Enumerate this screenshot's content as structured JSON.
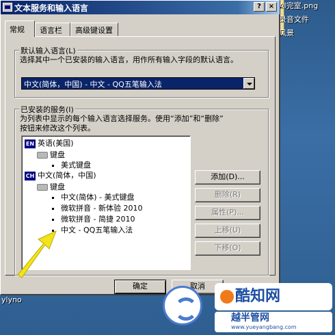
{
  "desktop": {
    "items": [
      {
        "label": "AI完室.png"
      },
      {
        "label": "录音文件"
      },
      {
        "label": "风景"
      },
      {
        "label": "ylyno"
      }
    ]
  },
  "window": {
    "title": "文本服务和输入语言",
    "help_glyph": "?",
    "close_glyph": "×"
  },
  "tabs": [
    {
      "label": "常规"
    },
    {
      "label": "语言栏"
    },
    {
      "label": "高级键设置"
    }
  ],
  "default_language": {
    "legend": "默认输入语言(L)",
    "description": "选择其中一个已安装的输入语言，用作所有输入字段的默认语言。",
    "selected": "中文(简体，中国) - 中文 - QQ五笔输入法"
  },
  "installed_services": {
    "legend": "已安装的服务(I)",
    "description_line1": "为列表中显示的每个输入语言选择服务。使用“添加”和“删除”",
    "description_line2": "按钮来修改这个列表。",
    "tree": [
      {
        "kind": "lang",
        "badge": "EN",
        "label": "英语(美国)"
      },
      {
        "kind": "category",
        "label": "键盘"
      },
      {
        "kind": "service",
        "label": "美式键盘"
      },
      {
        "kind": "lang",
        "badge": "CH",
        "label": "中文(简体，中国)"
      },
      {
        "kind": "category",
        "label": "键盘"
      },
      {
        "kind": "service",
        "label": "中文(简体) - 美式键盘"
      },
      {
        "kind": "service",
        "label": "微软拼音 - 新体验 2010"
      },
      {
        "kind": "service",
        "label": "微软拼音 - 简捷 2010"
      },
      {
        "kind": "service",
        "label": "中文 - QQ五笔输入法"
      }
    ]
  },
  "buttons": {
    "add": "添加(D)...",
    "remove": "删除(R)",
    "properties": "属性(P)...",
    "move_up": "上移(U)",
    "move_down": "下移(O)",
    "ok": "确定",
    "cancel": "取消"
  },
  "watermark": {
    "brand": "酷知网",
    "sub": "越半管网",
    "url": "www.yueyangbang.com"
  },
  "colors": {
    "titlebar_start": "#0a246a",
    "selection": "#0a246a",
    "annotation_arrow": "#f2e41a",
    "watermark_blue": "#1d4fa3"
  }
}
